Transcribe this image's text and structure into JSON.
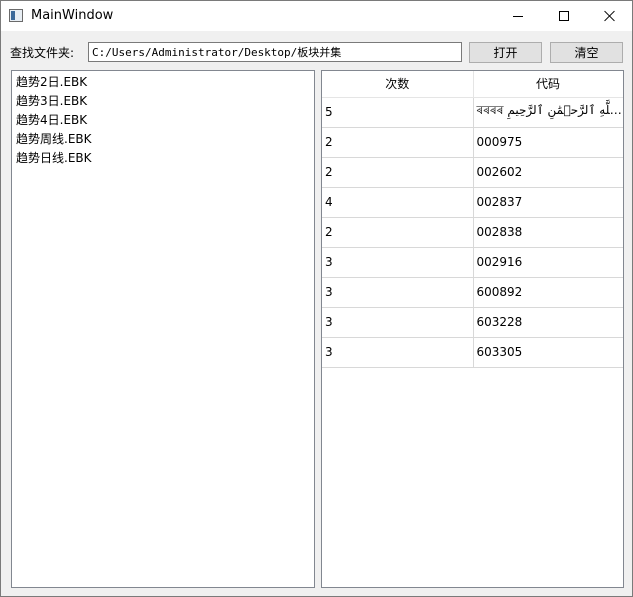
{
  "window": {
    "title": "MainWindow"
  },
  "toolbar": {
    "search_label": "查找文件夹:",
    "path_value": "C:/Users/Administrator/Desktop/板块并集",
    "open_label": "打开",
    "clear_label": "清空"
  },
  "files": [
    "趋势2日.EBK",
    "趋势3日.EBK",
    "趋势4日.EBK",
    "趋势周线.EBK",
    "趋势日线.EBK"
  ],
  "table": {
    "headers": [
      "次数",
      "代码"
    ],
    "rows": [
      [
        "5",
        "ৰৰৰৰ بِسۡمِ ٱللَّهِ ٱلرَّحۡمَٰنِ ٱلرَّحِيمِ..."
      ],
      [
        "2",
        "000975"
      ],
      [
        "2",
        "002602"
      ],
      [
        "4",
        "002837"
      ],
      [
        "2",
        "002838"
      ],
      [
        "3",
        "002916"
      ],
      [
        "3",
        "600892"
      ],
      [
        "3",
        "603228"
      ],
      [
        "3",
        "603305"
      ]
    ]
  }
}
